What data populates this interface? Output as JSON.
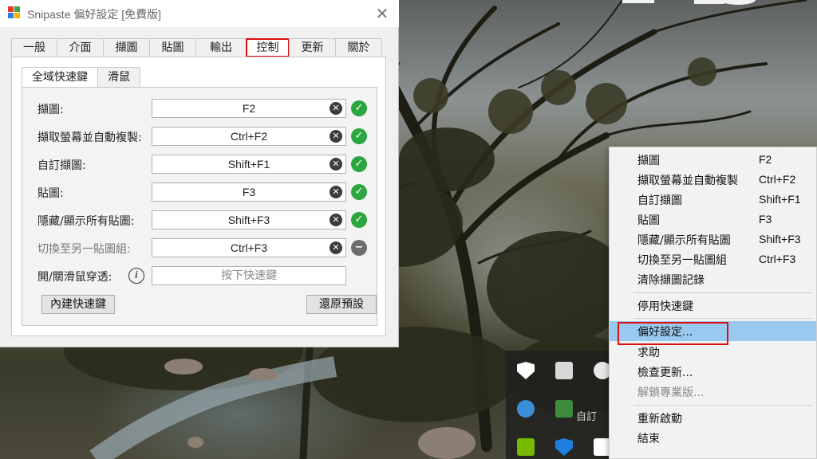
{
  "window": {
    "title": "Snipaste 偏好設定 [免費版]",
    "close_glyph": "✕",
    "logo_colors": [
      "#e8392a",
      "#37a344",
      "#2c7be5",
      "#f4b400"
    ]
  },
  "tabs": [
    {
      "label": "一般"
    },
    {
      "label": "介面"
    },
    {
      "label": "擷圖"
    },
    {
      "label": "貼圖"
    },
    {
      "label": "輸出"
    },
    {
      "label": "控制"
    },
    {
      "label": "更新"
    },
    {
      "label": "關於"
    }
  ],
  "active_tab": "控制",
  "subtabs": [
    {
      "label": "全域快速鍵"
    },
    {
      "label": "滑鼠"
    }
  ],
  "shortcuts": [
    {
      "label": "擷圖:",
      "value": "F2",
      "status": "ok"
    },
    {
      "label": "擷取螢幕並自動複製:",
      "value": "Ctrl+F2",
      "status": "ok"
    },
    {
      "label": "自訂擷圖:",
      "value": "Shift+F1",
      "status": "ok"
    },
    {
      "label": "貼圖:",
      "value": "F3",
      "status": "ok"
    },
    {
      "label": "隱藏/顯示所有貼圖:",
      "value": "Shift+F3",
      "status": "ok"
    },
    {
      "label": "切換至另一貼圖組:",
      "value": "Ctrl+F3",
      "status": "disabled"
    },
    {
      "label": "開/關滑鼠穿透:",
      "placeholder": "按下快速鍵"
    }
  ],
  "buttons": {
    "builtin": "內建快速鍵",
    "restore": "還原預設"
  },
  "icons": {
    "clear": "✕",
    "ok": "✓",
    "disabled": "−",
    "info": "i"
  },
  "tray": {
    "label": "自訂"
  },
  "context_menu": {
    "items": [
      {
        "label": "擷圖",
        "key": "F2"
      },
      {
        "label": "擷取螢幕並自動複製",
        "key": "Ctrl+F2"
      },
      {
        "label": "自訂擷圖",
        "key": "Shift+F1"
      },
      {
        "label": "貼圖",
        "key": "F3"
      },
      {
        "label": "隱藏/顯示所有貼圖",
        "key": "Shift+F3"
      },
      {
        "label": "切換至另一貼圖組",
        "key": "Ctrl+F3"
      },
      {
        "label": "清除擷圖記錄"
      },
      {
        "label": "停用快速鍵"
      },
      {
        "label": "偏好設定...",
        "selected": true
      },
      {
        "label": "求助"
      },
      {
        "label": "檢查更新..."
      },
      {
        "label": "解鎖專業版...",
        "disabled": true
      },
      {
        "label": "重新啟動"
      },
      {
        "label": "結束"
      }
    ]
  }
}
